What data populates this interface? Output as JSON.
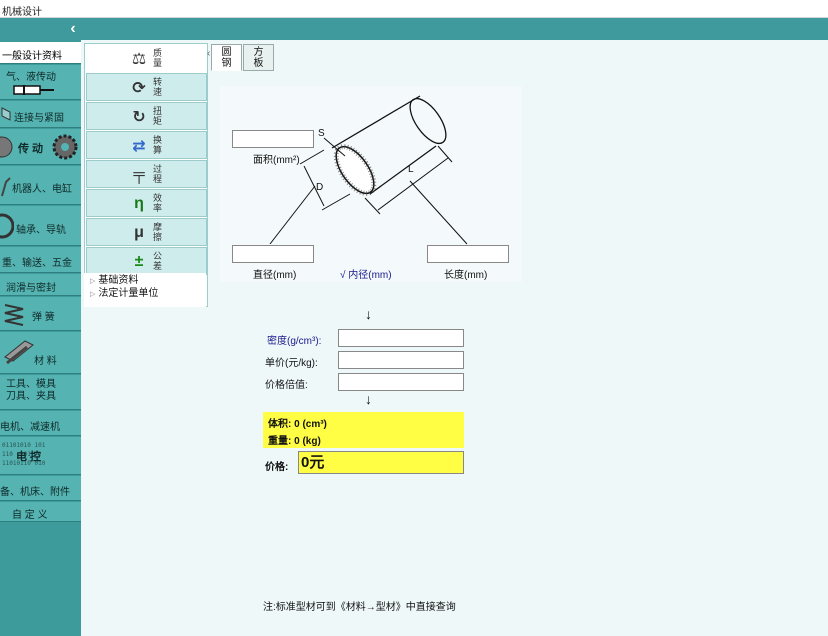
{
  "window": {
    "title": "机械设计"
  },
  "sidebar": {
    "items": [
      {
        "label": "一般设计资料",
        "icon": "document-icon",
        "active": true
      },
      {
        "label": "气、液传动",
        "icon": "cylinder-icon"
      },
      {
        "label": "连接与紧固",
        "icon": "bolt-icon"
      },
      {
        "label": "传 动",
        "icon": "gear-icon"
      },
      {
        "label": "机器人、电缸",
        "icon": "robot-arm-icon"
      },
      {
        "label": "轴承、导轨",
        "icon": "bearing-icon"
      },
      {
        "label": "重、输送、五金",
        "icon": "hook-icon"
      },
      {
        "label": "润滑与密封",
        "icon": "seal-icon"
      },
      {
        "label": "弹 簧",
        "icon": "spring-icon"
      },
      {
        "label": "材 料",
        "icon": "i-beam-icon"
      },
      {
        "label": "工具、模具\n刀具、夹具",
        "icon": "tool-icon"
      },
      {
        "label": "电机、减速机",
        "icon": "motor-icon"
      },
      {
        "label": "电 控",
        "icon": "binary-icon",
        "deco_text": "01101010 101\n110  101\n11010110 010"
      },
      {
        "label": "备、机床、附件",
        "icon": "machine-icon"
      },
      {
        "label": "自 定 义",
        "icon": ""
      }
    ]
  },
  "sub_nav": {
    "items": [
      {
        "label": "质\n量",
        "icon": "balance-icon",
        "glyph": "⚖",
        "active": true
      },
      {
        "label": "转\n速",
        "icon": "rotation-icon",
        "glyph": "⟳"
      },
      {
        "label": "扭\n矩",
        "icon": "torque-icon",
        "glyph": "↻"
      },
      {
        "label": "换\n算",
        "icon": "conversion-icon",
        "glyph": "⇄"
      },
      {
        "label": "过\n程",
        "icon": "process-icon",
        "glyph": "╤"
      },
      {
        "label": "效\n率",
        "icon": "eta-icon",
        "glyph": "η"
      },
      {
        "label": "摩\n擦",
        "icon": "mu-icon",
        "glyph": "μ"
      },
      {
        "label": "公\n差",
        "icon": "tolerance-icon",
        "glyph": "±"
      }
    ],
    "tree": [
      {
        "label": "基础资料"
      },
      {
        "label": "法定计量单位"
      }
    ]
  },
  "tabs": [
    {
      "label": "圆\n钢",
      "active": true
    },
    {
      "label": "方\n板"
    }
  ],
  "diagram": {
    "labels": {
      "s": "S",
      "d": "D",
      "l": "L"
    },
    "area_label": "面积(mm²)",
    "diameter_label": "直径(mm)",
    "inner_label": "√ 内径(mm)",
    "length_label": "长度(mm)",
    "area_value": "",
    "diameter_value": "",
    "length_value": ""
  },
  "form": {
    "arrow": "↓",
    "density_label": "密度(g/cm³):",
    "unit_price_label": "单价(元/kg):",
    "price_multiplier_label": "价格倍值:",
    "density_value": "",
    "unit_price_value": "",
    "price_multiplier_value": ""
  },
  "result": {
    "volume": "体积:  0 (cm³)",
    "weight": "重量:  0 (kg)",
    "price_label": "价格:",
    "price_value": "0元"
  },
  "note": "注:标准型材可到《材料→型材》中直接查询",
  "colors": {
    "topbar": "#3e9a9c",
    "sidebar": "#55b3b1",
    "result_bg": "#fffd44",
    "blue_label": "#1a1a8c"
  }
}
